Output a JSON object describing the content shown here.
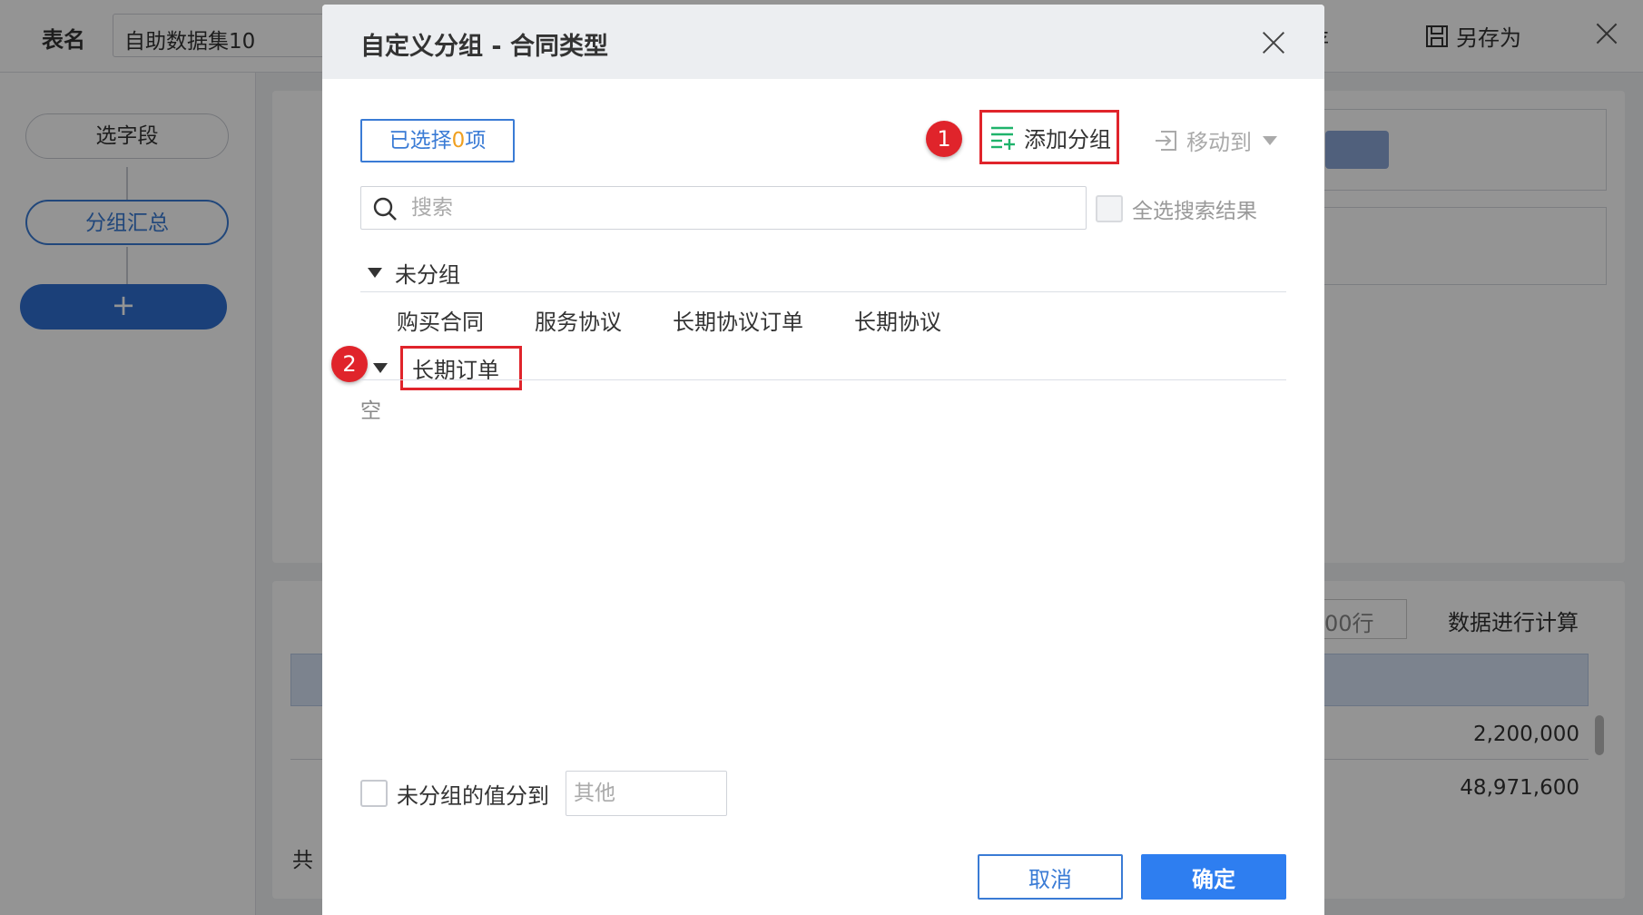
{
  "app": {
    "table_name_label": "表名",
    "table_name_value": "自助数据集10",
    "save_label": "存",
    "save_as_label": "另存为",
    "steps": [
      "选字段",
      "分组汇总"
    ],
    "add_step_label": "+",
    "rows_select": "00行",
    "rows_note": "数据进行计算",
    "table_values": [
      "2,200,000",
      "48,971,600"
    ],
    "footer_prefix": "共"
  },
  "dialog": {
    "title": "自定义分组 - 合同类型",
    "selected_prefix": "已选择",
    "selected_count": "0",
    "selected_suffix": "项",
    "add_group_label": "添加分组",
    "move_to_label": "移动到",
    "search_placeholder": "搜索",
    "select_all_results_label": "全选搜索结果",
    "groups": [
      {
        "name": "未分组",
        "items": [
          "购买合同",
          "服务协议",
          "长期协议订单",
          "长期协议"
        ]
      },
      {
        "name": "长期订单",
        "empty_text": "空"
      }
    ],
    "ungrouped_to_label": "未分组的值分到",
    "ungrouped_to_placeholder": "其他",
    "cancel_label": "取消",
    "ok_label": "确定"
  },
  "annotations": {
    "badge_1": "1",
    "badge_2": "2",
    "highlight_color": "#e0242b"
  },
  "colors": {
    "accent": "#3a7bd5",
    "primary_button": "#2e7ef0",
    "count_highlight": "#f0a020"
  }
}
